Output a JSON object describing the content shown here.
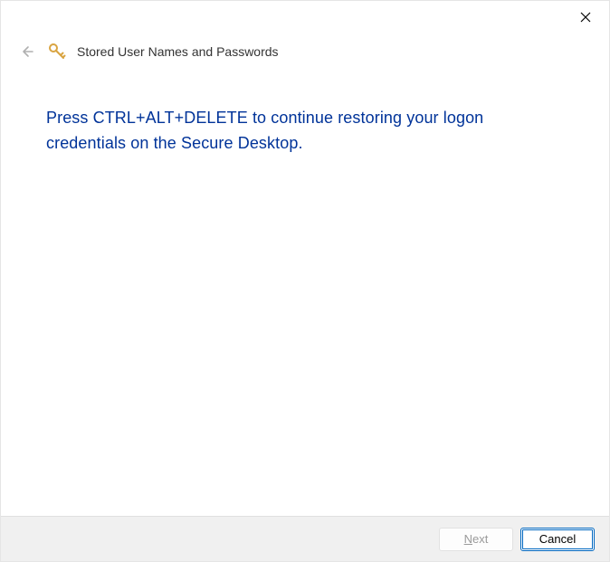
{
  "titlebar": {
    "close_label": "Close"
  },
  "header": {
    "title": "Stored User Names and Passwords"
  },
  "main": {
    "instruction": "Press CTRL+ALT+DELETE to continue restoring your logon credentials on the Secure Desktop."
  },
  "footer": {
    "next_prefix": "N",
    "next_suffix": "ext",
    "cancel_label": "Cancel"
  }
}
